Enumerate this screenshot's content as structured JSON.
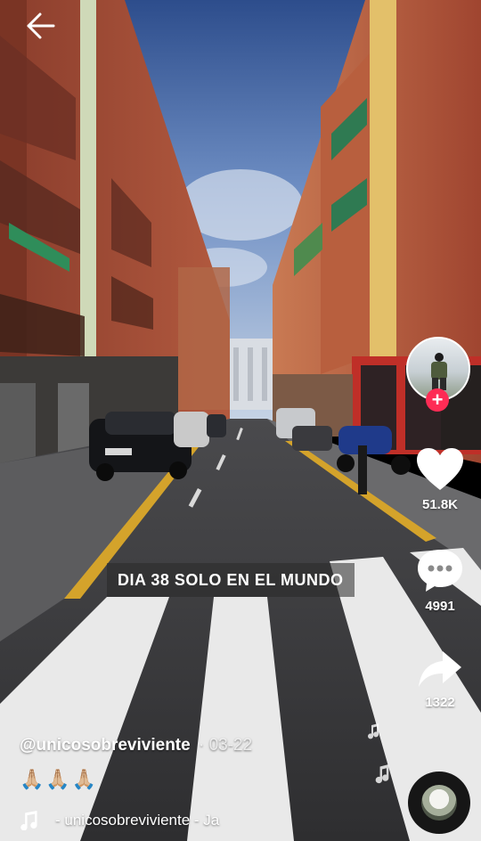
{
  "video": {
    "caption": "DIA 38 SOLO EN EL MUNDO"
  },
  "actions": {
    "likes": "51.8K",
    "comments": "4991",
    "shares": "1322"
  },
  "post": {
    "username": "@unicosobreviviente",
    "date": "· 03-22",
    "description": "🙏🏼🙏🏼🙏🏼",
    "sound": "- unicosobreviviente - Ja"
  },
  "icons": {
    "back": "back-arrow-icon",
    "like": "heart-icon",
    "comment": "comment-bubble-icon",
    "share": "share-arrow-icon",
    "follow": "plus-icon",
    "music": "music-note-icon"
  },
  "colors": {
    "follow_accent": "#fe2c55"
  }
}
